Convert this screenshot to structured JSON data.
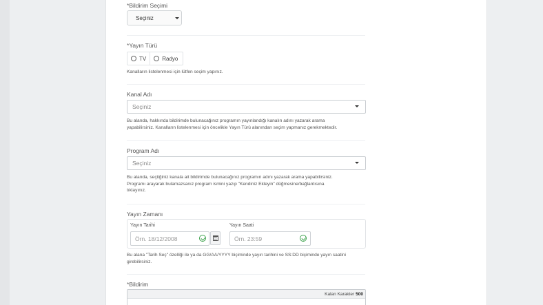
{
  "form": {
    "bildirim_secimi": {
      "required_mark": "*",
      "label": "Bildirim Seçimi",
      "select_value": "Seçiniz"
    },
    "yayin_turu": {
      "required_mark": "*",
      "label": "Yayın Türü",
      "options": [
        "TV",
        "Radyo"
      ],
      "help": "Kanalların listelenmesi için lütfen seçim yapınız."
    },
    "kanal_adi": {
      "label": "Kanal Adı",
      "placeholder": "Seçiniz",
      "help_line1": "Bu alanda, hakkında bildirimde bulunacağınız programın yayınlandığı kanalın adını yazarak arama",
      "help_line2": "yapabilirsiniz. Kanalların listelenmesi için öncelikle Yayın Türü alanından seçim yapmanız gerekmektedir."
    },
    "program_adi": {
      "label": "Program Adı",
      "placeholder": "Seçiniz",
      "help_line1": "Bu alanda, seçtiğiniz kanala ait bildirimde bulunacağınız programın adını yazarak arama yapabilirsiniz.",
      "help_line2": "Programı arayarak bulamazsanız program ismini yazıp \"Kendiniz Ekleyin\" düğmesine/bağlantısına",
      "help_line3": "tıklayınız."
    },
    "yayin_zamani": {
      "label": "Yayın Zamanı",
      "tarih_label": "Yayın Tarihi",
      "tarih_placeholder": "Örn. 18/12/2008",
      "saat_label": "Yayın Saati",
      "saat_placeholder": "Örn. 23:59",
      "help_line1": "Bu alana \"Tarih Seç\" özelliği ile ya da GG/AA/YYYY biçiminde yayın tarihini ve SS:DD biçiminde yayın saatini",
      "help_line2": "girebilirsiniz."
    },
    "bildirim": {
      "required_mark": "*",
      "label": "Bildirim",
      "counter_label": "Kalan Karakter",
      "counter_value": "500"
    }
  },
  "colors": {
    "success": "#3aa14a",
    "background": "#edeff1"
  }
}
